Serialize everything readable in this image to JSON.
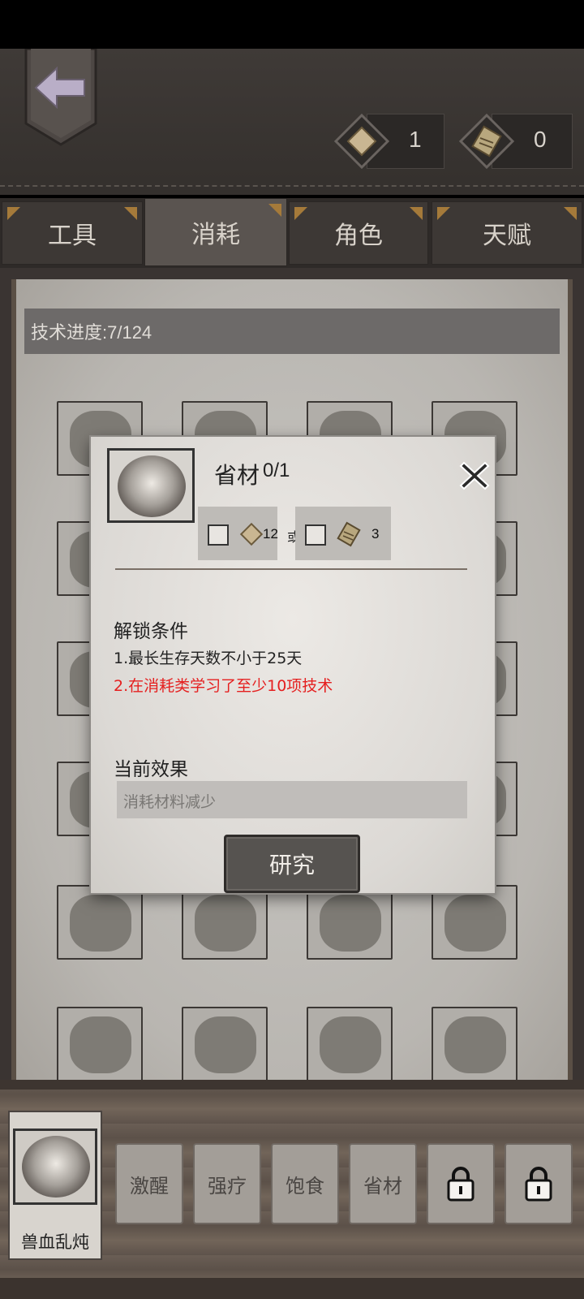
{
  "header": {
    "back_label": "back",
    "resources": [
      {
        "icon": "research-scroll-icon",
        "value": "1"
      },
      {
        "icon": "map-parchment-icon",
        "value": "0"
      }
    ]
  },
  "tabs": [
    {
      "label": "工具",
      "active": false
    },
    {
      "label": "消耗",
      "active": true
    },
    {
      "label": "角色",
      "active": false
    },
    {
      "label": "天赋",
      "active": false
    }
  ],
  "progress": {
    "label": "技术进度:7/124"
  },
  "modal": {
    "title": "省材",
    "count": "0/1",
    "cost_a": {
      "amount": "12"
    },
    "or_text": "或",
    "cost_b": {
      "amount": "3"
    },
    "unlock_heading": "解锁条件",
    "condition_1": "1.最长生存天数不小于25天",
    "condition_2": "2.在消耗类学习了至少10项技术",
    "effect_heading": "当前效果",
    "effect_text": "消耗材料减少",
    "research_label": "研究",
    "condition_2_color": "#e51f1f"
  },
  "selected": {
    "name": "兽血乱炖"
  },
  "skills": [
    {
      "label": "激醒"
    },
    {
      "label": "强疗"
    },
    {
      "label": "饱食"
    },
    {
      "label": "省材"
    }
  ]
}
